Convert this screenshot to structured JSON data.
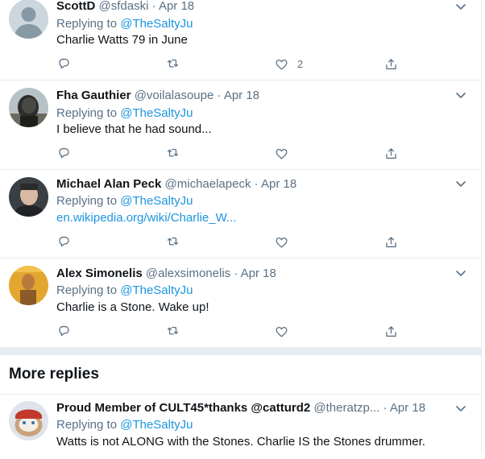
{
  "tweets": [
    {
      "name": "ScottD",
      "handle": "@sfdaski",
      "date": "· Apr 18",
      "replying_label": "Replying to",
      "replying_handle": "@TheSaltyJu",
      "text": "Charlie Watts 79 in June",
      "likes": "2"
    },
    {
      "name": "Fha Gauthier",
      "handle": "@voilalasoupe",
      "date": "· Apr 18",
      "replying_label": "Replying to",
      "replying_handle": "@TheSaltyJu",
      "text": "I believe that he had sound...",
      "likes": ""
    },
    {
      "name": "Michael Alan Peck",
      "handle": "@michaelapeck",
      "date": "· Apr 18",
      "replying_label": "Replying to",
      "replying_handle": "@TheSaltyJu",
      "text": "en.wikipedia.org/wiki/Charlie_W...",
      "likes": ""
    },
    {
      "name": "Alex Simonelis",
      "handle": "@alexsimonelis",
      "date": "· Apr 18",
      "replying_label": "Replying to",
      "replying_handle": "@TheSaltyJu",
      "text": "Charlie is a Stone. Wake up!",
      "likes": ""
    },
    {
      "name": "Proud Member of CULT45*thanks @catturd2",
      "handle": "@theratzp...",
      "date": "· Apr 18",
      "replying_label": "Replying to",
      "replying_handle": "@TheSaltyJu",
      "text": "Watts is not ALONG with the Stones. Charlie IS the Stones drummer.",
      "likes": ""
    }
  ],
  "more_replies_label": "More replies",
  "colors": {
    "accent": "#1b95e0",
    "muted": "#5b7083",
    "border": "#e6ecf0"
  },
  "icons": [
    "reply-icon",
    "retweet-icon",
    "like-icon",
    "share-icon",
    "chevron-down-icon"
  ]
}
